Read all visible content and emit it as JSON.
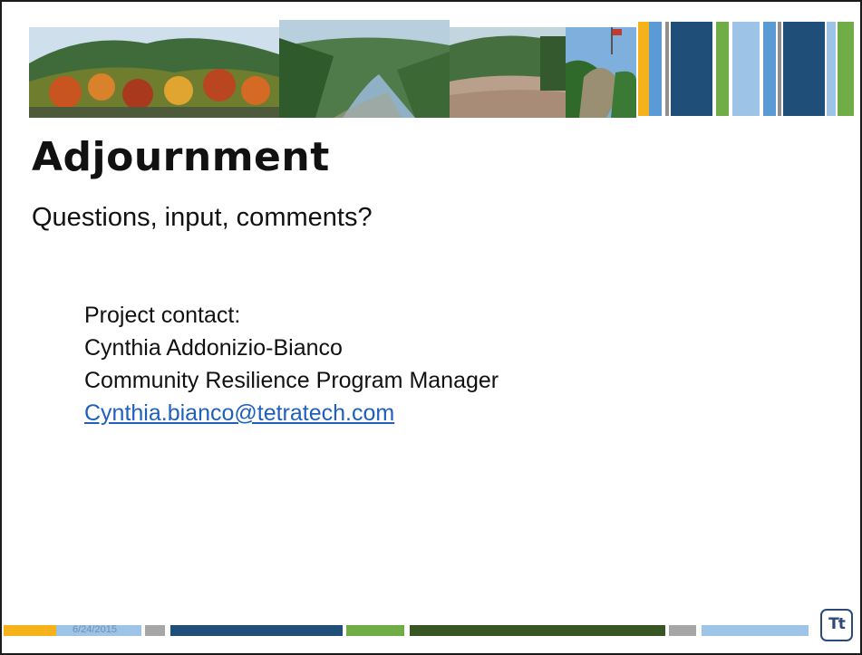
{
  "slide": {
    "title": "Adjournment",
    "subtitle": "Questions, input, comments?",
    "contact": {
      "label": "Project contact:",
      "name": "Cynthia Addonizio-Bianco",
      "role": "Community Resilience Program Manager",
      "email": "Cynthia.bianco@tetratech.com",
      "email_href": "mailto:Cynthia.bianco@tetratech.com"
    },
    "footer": {
      "date": "6/24/2015"
    },
    "logo": {
      "text": "Tt",
      "icon": "tetra-tech-logo-icon"
    }
  },
  "colors": {
    "gold": "#f5b21a",
    "light_blue": "#9dc3e6",
    "mid_blue": "#5b9bd5",
    "navy": "#1f4e79",
    "green": "#70ad47",
    "dark_green": "#375623",
    "gray": "#a6a6a6",
    "link": "#1f5fbf"
  }
}
